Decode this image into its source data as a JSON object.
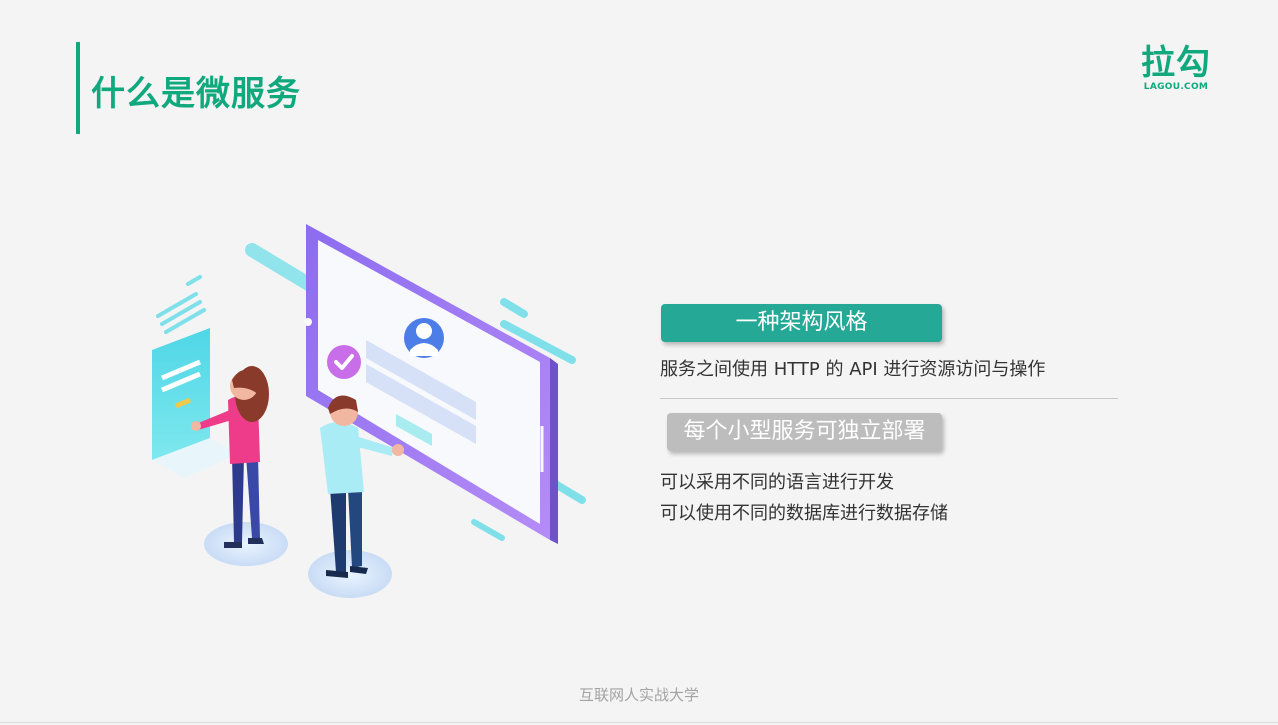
{
  "header": {
    "title": "什么是微服务",
    "logo_main": "拉勾",
    "logo_sub": "LAGOU.COM",
    "accent_color": "#10a87d"
  },
  "points": [
    {
      "label": "一种架构风格",
      "color": "#25a896",
      "lines": [
        "服务之间使用 HTTP 的 API 进行资源访问与操作"
      ]
    },
    {
      "label": "每个小型服务可独立部署",
      "color": "#bdbdbd",
      "lines": [
        "可以采用不同的语言进行开发",
        "可以使用不同的数据库进行数据存储"
      ]
    }
  ],
  "footer": {
    "text": "互联网人实战大学"
  },
  "illustration": {
    "icons": [
      "user-avatar-icon",
      "checkmark-icon"
    ]
  }
}
